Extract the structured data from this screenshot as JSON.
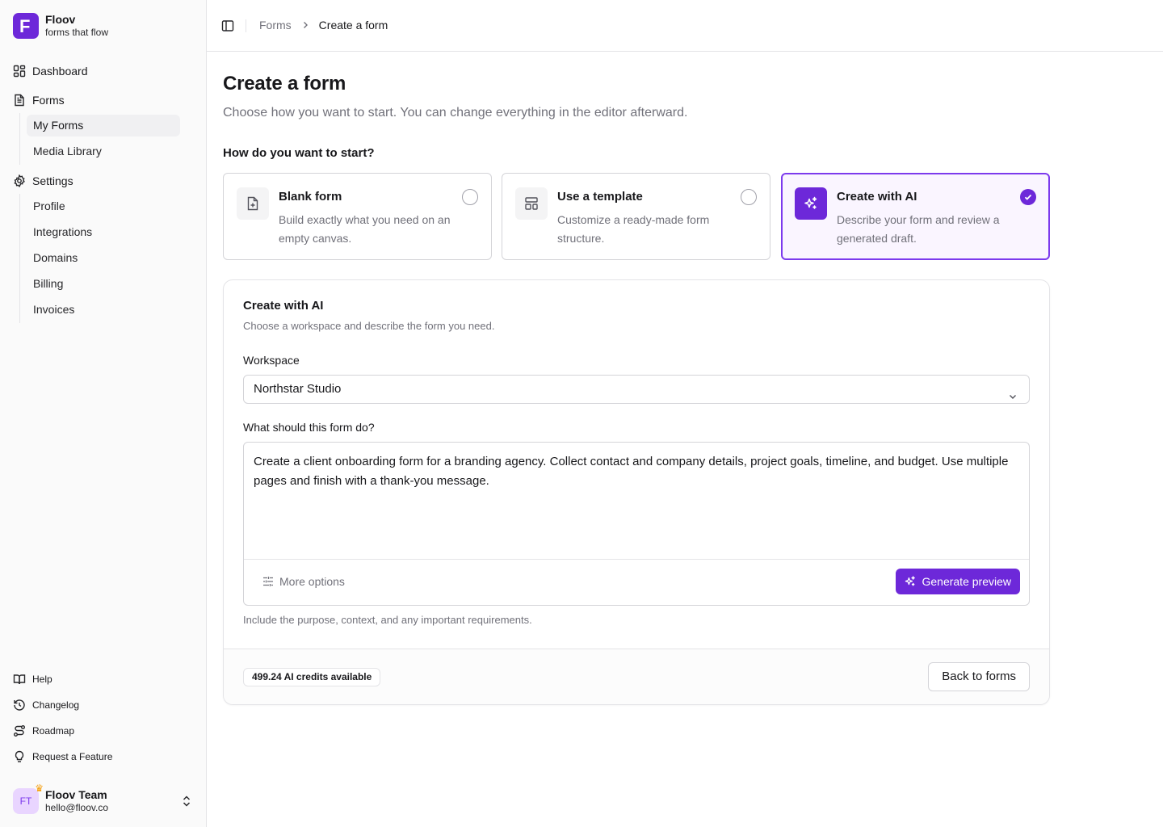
{
  "brand": {
    "name": "Floov",
    "tagline": "forms that flow",
    "logo_letter": "F"
  },
  "sidebar": {
    "nav": {
      "dashboard": "Dashboard",
      "forms": "Forms",
      "my_forms": "My Forms",
      "media_library": "Media Library",
      "settings": "Settings",
      "profile": "Profile",
      "integrations": "Integrations",
      "domains": "Domains",
      "billing": "Billing",
      "invoices": "Invoices"
    },
    "footer": {
      "help": "Help",
      "changelog": "Changelog",
      "roadmap": "Roadmap",
      "request_feature": "Request a Feature"
    },
    "user": {
      "initials": "FT",
      "name": "Floov Team",
      "email": "hello@floov.co"
    }
  },
  "breadcrumb": {
    "parent": "Forms",
    "current": "Create a form"
  },
  "page": {
    "title": "Create a form",
    "subtitle": "Choose how you want to start. You can change everything in the editor afterward.",
    "section_label": "How do you want to start?"
  },
  "options": {
    "blank": {
      "title": "Blank form",
      "desc": "Build exactly what you need on an empty canvas.",
      "selected": false
    },
    "template": {
      "title": "Use a template",
      "desc": "Customize a ready-made form structure.",
      "selected": false
    },
    "ai": {
      "title": "Create with AI",
      "desc": "Describe your form and review a generated draft.",
      "selected": true
    }
  },
  "ai_panel": {
    "title": "Create with AI",
    "subtitle": "Choose a workspace and describe the form you need.",
    "workspace_label": "Workspace",
    "workspace_value": "Northstar Studio",
    "prompt_label": "What should this form do?",
    "prompt_value": "Create a client onboarding form for a branding agency. Collect contact and company details, project goals, timeline, and budget. Use multiple pages and finish with a thank-you message.",
    "more_options": "More options",
    "generate_button": "Generate preview",
    "helper": "Include the purpose, context, and any important requirements.",
    "credits": "499.24 AI credits available",
    "back_button": "Back to forms"
  },
  "colors": {
    "accent": "#6d28d9",
    "accent_light": "#faf5ff",
    "muted": "#71717a",
    "border": "#e4e4e7"
  }
}
